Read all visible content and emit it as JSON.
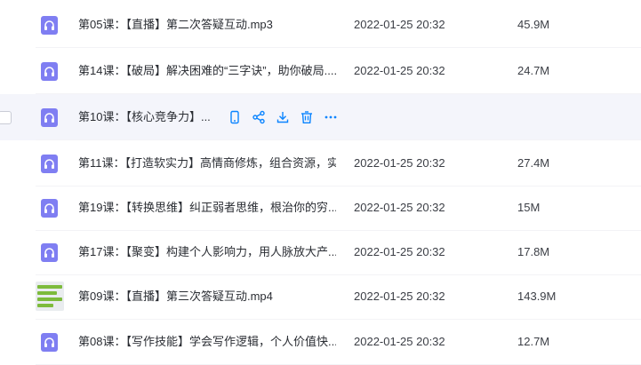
{
  "files": [
    {
      "name": "第05课：【直播】第二次答疑互动.mp3",
      "date": "2022-01-25 20:32",
      "size": "45.9M",
      "type": "audio"
    },
    {
      "name": "第14课：【破局】解决困难的“三字诀”，助你破局....",
      "date": "2022-01-25 20:32",
      "size": "24.7M",
      "type": "audio"
    },
    {
      "name": "第10课：【核心竞争力】...",
      "date": "",
      "size": "",
      "type": "audio",
      "hovered": true
    },
    {
      "name": "第11课：【打造软实力】高情商修炼，组合资源，实...",
      "date": "2022-01-25 20:32",
      "size": "27.4M",
      "type": "audio"
    },
    {
      "name": "第19课：【转换思维】纠正弱者思维，根治你的穷...",
      "date": "2022-01-25 20:32",
      "size": "15M",
      "type": "audio"
    },
    {
      "name": "第17课：【聚变】构建个人影响力，用人脉放大产...",
      "date": "2022-01-25 20:32",
      "size": "17.8M",
      "type": "audio"
    },
    {
      "name": "第09课：【直播】第三次答疑互动.mp4",
      "date": "2022-01-25 20:32",
      "size": "143.9M",
      "type": "video"
    },
    {
      "name": "第08课：【写作技能】学会写作逻辑，个人价值快...",
      "date": "2022-01-25 20:32",
      "size": "12.7M",
      "type": "audio"
    }
  ],
  "hover_actions": [
    {
      "icon": "phone-icon",
      "name": "send-to-phone-button"
    },
    {
      "icon": "share-icon",
      "name": "share-button"
    },
    {
      "icon": "download-icon",
      "name": "download-button"
    },
    {
      "icon": "trash-icon",
      "name": "delete-button"
    },
    {
      "icon": "more-icon",
      "name": "more-button"
    }
  ],
  "colors": {
    "accent": "#0a84ff",
    "audio_icon": "#7f7ef2",
    "video_thumb": "#7dbb3c",
    "hover_row": "#f4f5fb"
  }
}
